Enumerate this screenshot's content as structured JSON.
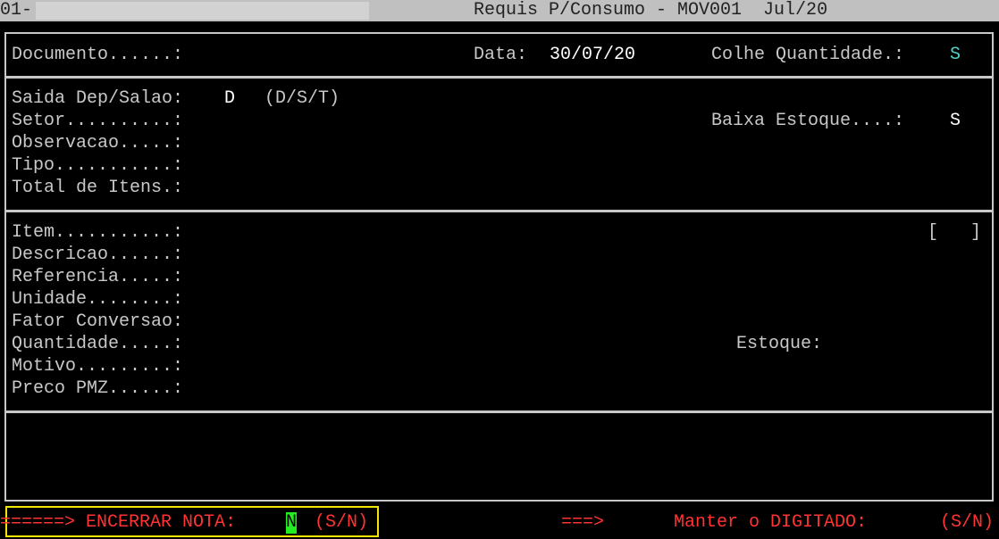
{
  "titlebar": {
    "prefix": "01-",
    "title": "Requis P/Consumo - MOV001  Jul/20"
  },
  "header": {
    "documento_label": "Documento......:",
    "data_label": "Data:",
    "data_value": "30/07/20",
    "colhe_label": "Colhe Quantidade.:",
    "colhe_value": "S"
  },
  "section2": {
    "saida_label": "Saida Dep/Salao:",
    "saida_value": "D",
    "saida_options": "(D/S/T)",
    "setor_label": "Setor..........:",
    "baixa_label": "Baixa Estoque....:",
    "baixa_value": "S",
    "observacao_label": "Observacao.....:",
    "tipo_label": "Tipo...........:",
    "total_label": "Total de Itens.:"
  },
  "section3": {
    "item_label": "Item...........:",
    "item_bracket": "[   ]",
    "descricao_label": "Descricao......:",
    "referencia_label": "Referencia.....:",
    "unidade_label": "Unidade........:",
    "fator_label": "Fator Conversao:",
    "quantidade_label": "Quantidade.....:",
    "estoque_label": "Estoque:",
    "motivo_label": "Motivo.........:",
    "preco_label": "Preco PMZ......:"
  },
  "footer": {
    "encerrar_prompt": "======> ENCERRAR NOTA:",
    "encerrar_value": "N",
    "encerrar_options": "(S/N)",
    "arrow": "===>",
    "manter_prompt": "Manter o DIGITADO:",
    "manter_options": "(S/N)"
  }
}
